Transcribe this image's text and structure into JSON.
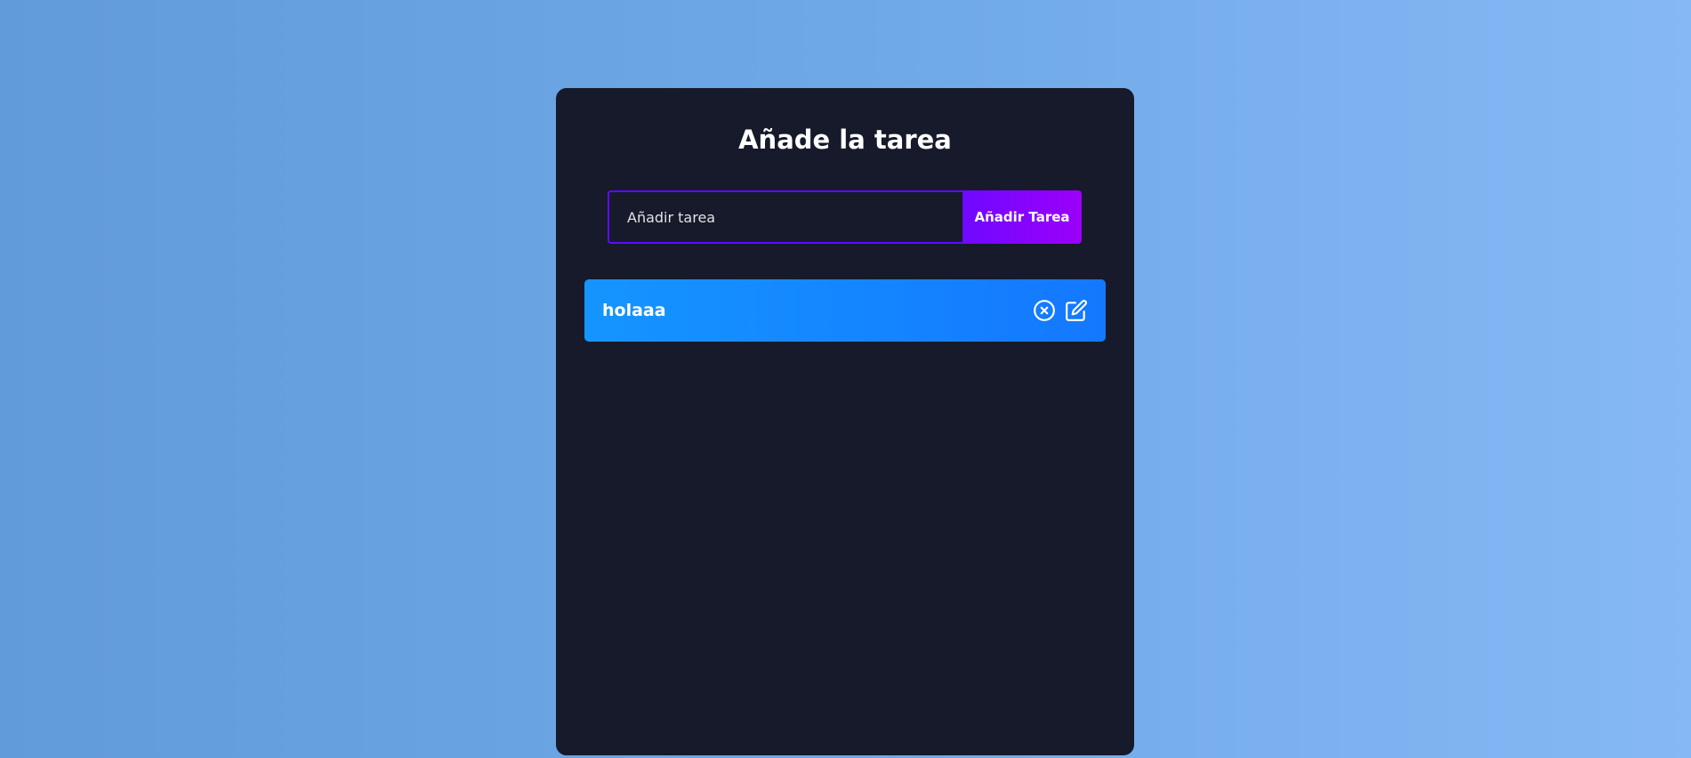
{
  "app": {
    "title": "Añade la tarea"
  },
  "form": {
    "placeholder": "Añadir tarea",
    "value": "",
    "button_label": "Añadir Tarea"
  },
  "tasks": [
    {
      "text": "holaaa",
      "icons": [
        "close-circle-icon",
        "edit-icon"
      ]
    }
  ],
  "colors": {
    "card_bg": "#161a2b",
    "accent_purple": "#5d0cff",
    "button_gradient_start": "#7008ff",
    "button_gradient_end": "#9b00fa",
    "task_gradient_start": "#1595ff",
    "task_gradient_end": "#1478ff"
  }
}
